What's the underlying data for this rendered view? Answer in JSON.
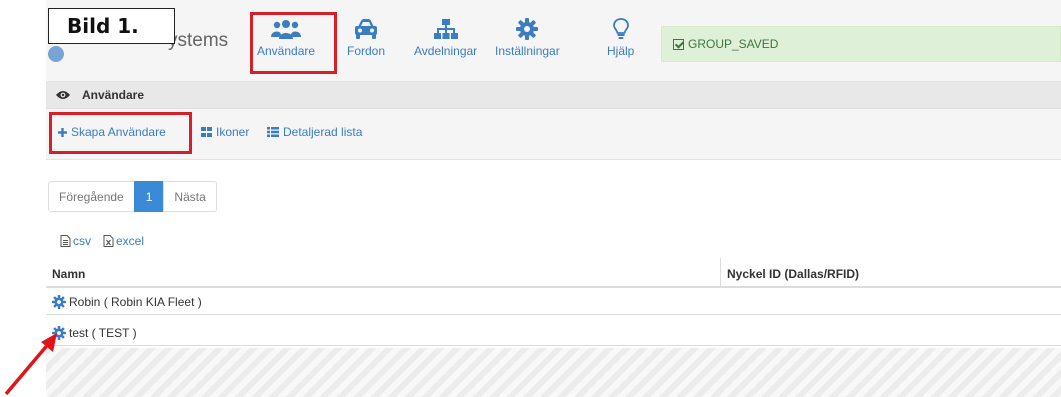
{
  "annotation": {
    "label": "Bild 1."
  },
  "brand": {
    "text": "ystems"
  },
  "nav": {
    "items": [
      {
        "label": "Användare",
        "icon": "users-icon"
      },
      {
        "label": "Fordon",
        "icon": "car-icon"
      },
      {
        "label": "Avdelningar",
        "icon": "sitemap-icon"
      },
      {
        "label": "Inställningar",
        "icon": "gear-icon"
      },
      {
        "label": "Hjälp",
        "icon": "lightbulb-icon"
      }
    ]
  },
  "alert": {
    "text": "GROUP_SAVED"
  },
  "panel": {
    "title": "Användare"
  },
  "toolbar": {
    "create_label": "Skapa Användare",
    "icons_label": "Ikoner",
    "detail_label": "Detaljerad lista"
  },
  "pagination": {
    "prev": "Föregående",
    "current": "1",
    "next": "Nästa"
  },
  "export": {
    "csv": "csv",
    "excel": "excel"
  },
  "table": {
    "columns": [
      "Namn",
      "Nyckel ID (Dallas/RFID)"
    ],
    "rows": [
      {
        "name": "Robin ( Robin KIA Fleet )",
        "key_id": ""
      },
      {
        "name": "test ( TEST )",
        "key_id": ""
      }
    ]
  },
  "colors": {
    "accent": "#3a7dc0",
    "highlight": "#d32029",
    "success_bg": "#dff0d8",
    "pager_active": "#3a8ad6"
  }
}
